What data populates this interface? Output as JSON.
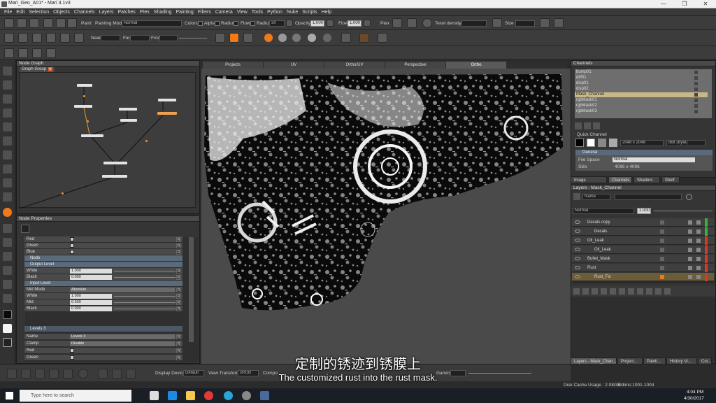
{
  "window": {
    "title": "Mari_Geo_A01* - Mari 3.1v3"
  },
  "menu": [
    "File",
    "Edit",
    "Selection",
    "Objects",
    "Channels",
    "Layers",
    "Patches",
    "Ptex",
    "Shading",
    "Painting",
    "Filters",
    "Camera",
    "View",
    "Tools",
    "Python",
    "Nuke",
    "Scripts",
    "Help"
  ],
  "toolbar1": {
    "paint_label": "Paint",
    "painting_mode_label": "Painting Mode",
    "painting_mode_value": "Normal",
    "colors_label": "Colors",
    "alpha_label": "Alpha",
    "radius_label": "Radius",
    "flow_label": "Flow",
    "radius2_label": "Radius",
    "radius_value": "30",
    "opacity_label": "Opacity",
    "opacity_value": "1.000",
    "flow2_label": "Flow",
    "flow_value": "1.000",
    "ptex_label": "Ptex",
    "texel_density_label": "Texel density",
    "size_label": "Size"
  },
  "toolbar2": {
    "near_label": "Near",
    "far_label": "Far",
    "fov_label": "FoV"
  },
  "node_graph": {
    "title": "Node Graph",
    "tab": "Graph Group",
    "nodes": [
      {
        "label": "Paint_1",
        "hl": false
      },
      {
        "label": "Paint_2",
        "hl": false
      },
      {
        "label": "Paint_3",
        "hl": false
      },
      {
        "label": "Paint_4",
        "hl": false
      },
      {
        "label": "Paint_5",
        "hl": true
      },
      {
        "label": "Merge",
        "hl": false
      },
      {
        "label": "Levels",
        "hl": false
      },
      {
        "label": "Output",
        "hl": false
      }
    ]
  },
  "node_properties": {
    "title": "Node Properties",
    "rows": [
      {
        "kind": "check",
        "label": "Red"
      },
      {
        "kind": "check",
        "label": "Green"
      },
      {
        "kind": "check",
        "label": "Blue"
      },
      {
        "kind": "sub",
        "label": "Node"
      },
      {
        "kind": "sub",
        "label": "Output Level"
      },
      {
        "kind": "value",
        "label": "White",
        "value": "1.000"
      },
      {
        "kind": "value",
        "label": "Black",
        "value": "0.000"
      },
      {
        "kind": "sub",
        "label": "Input Level"
      },
      {
        "kind": "select",
        "label": "Mid Mode",
        "value": "Absolute"
      },
      {
        "kind": "value",
        "label": "White",
        "value": "1.000"
      },
      {
        "kind": "value",
        "label": "Mid",
        "value": "0.500"
      },
      {
        "kind": "value",
        "label": "Black",
        "value": "0.000"
      }
    ],
    "levels3": {
      "header": "Levels 3",
      "rows": [
        {
          "kind": "text",
          "label": "Name",
          "value": "Levels 3"
        },
        {
          "kind": "select",
          "label": "Clamp",
          "value": "Disable"
        },
        {
          "kind": "check",
          "label": "Red"
        },
        {
          "kind": "check",
          "label": "Green"
        }
      ]
    }
  },
  "viewport_tabs": [
    "Projects",
    "UV",
    "Ortho/UV",
    "Perspective",
    "Ortho"
  ],
  "bottom_bar": {
    "display_device_label": "Display Device",
    "display_device_value": "Default",
    "view_transform_label": "View Transform",
    "view_transform_value": "sRGB",
    "compo_label": "Compo",
    "gamma_label": "Gamma"
  },
  "channels": {
    "title": "Channels",
    "items": [
      "bump01",
      "diff01",
      "disp01",
      "disp02",
      "Mask_Channel",
      "rgbMask01",
      "rgbMask02",
      "rgbMask03"
    ],
    "selected_index": 4,
    "quick_channel_label": "Quick Channel",
    "resolution": "2048 x 2048",
    "depth": "8bit (Byte)",
    "general_label": "General",
    "file_space_label": "File Space",
    "file_space_value": "Normal",
    "size_label": "Size",
    "size_value": "4096 x 4096"
  },
  "right_tabs": [
    "Image Manager",
    "Channels",
    "Shaders",
    "Shelf"
  ],
  "layers": {
    "title": "Layers - Mask_Channel",
    "search_value": "Name",
    "blend_mode": "Normal",
    "opacity": "1.000",
    "items": [
      {
        "name": "Decals copy",
        "indent": 0,
        "selected": false
      },
      {
        "name": "Decals",
        "indent": 1,
        "selected": false
      },
      {
        "name": "Oil_Leak",
        "indent": 0,
        "selected": false
      },
      {
        "name": "Oil_Leak",
        "indent": 1,
        "selected": false
      },
      {
        "name": "Bullet_Mask",
        "indent": 0,
        "selected": false
      },
      {
        "name": "Rust",
        "indent": 0,
        "selected": false
      },
      {
        "name": "Rust_Fix",
        "indent": 1,
        "selected": true
      }
    ]
  },
  "bottom_right_tabs": [
    "Layers - Mask_Chan...",
    "Project...",
    "Painti...",
    "History Vi...",
    "Col..."
  ],
  "status": {
    "disk_cache": "Disk Cache Usage : 2.08GB",
    "udims": "Udims:1001-1004"
  },
  "subtitles": {
    "zh": "定制的锈迹到锈膜上",
    "en": "The customized rust into the rust mask."
  },
  "taskbar": {
    "search_placeholder": "Type here to search",
    "time": "4:04 PM",
    "date": "4/30/2017"
  },
  "colors": {
    "accent_orange": "#f07a1a",
    "selected_row": "#6b5d3a",
    "node_highlight": "#f0a050"
  }
}
